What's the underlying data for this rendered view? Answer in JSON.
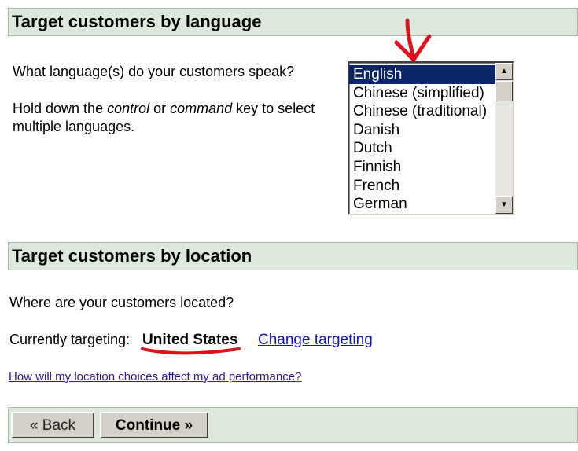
{
  "language_section": {
    "header": "Target customers by language",
    "question": "What language(s) do your customers speak?",
    "hint_pre": "Hold down the ",
    "hint_key1": "control",
    "hint_mid": " or ",
    "hint_key2": "command",
    "hint_post_line1": " key to select",
    "hint_line2": "multiple languages.",
    "listbox": {
      "selected": "English",
      "options": [
        "English",
        "Chinese (simplified)",
        "Chinese (traditional)",
        "Danish",
        "Dutch",
        "Finnish",
        "French",
        "German"
      ]
    }
  },
  "location_section": {
    "header": "Target customers by location",
    "question": "Where are your customers located?",
    "current_label": "Currently targeting:",
    "current_value": "United States",
    "change_link": "Change targeting",
    "help_link": "How will my location choices affect my ad performance?"
  },
  "footer": {
    "back_label": "« Back",
    "continue_label": "Continue »"
  },
  "colors": {
    "header_bg": "#dde8dd",
    "selection_bg": "#0a246a",
    "annotation_red": "#e0101a",
    "link": "#1010c8"
  }
}
